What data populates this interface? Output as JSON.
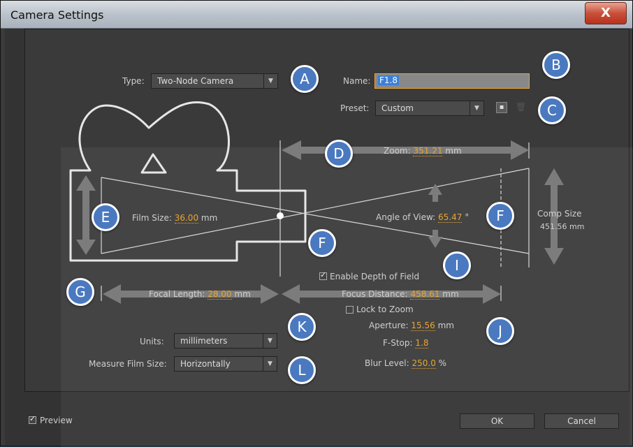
{
  "window": {
    "title": "Camera Settings",
    "close_label": "X"
  },
  "type": {
    "label": "Type:",
    "value": "Two-Node Camera"
  },
  "name": {
    "label": "Name:",
    "value": "F1.8"
  },
  "preset": {
    "label": "Preset:",
    "value": "Custom"
  },
  "zoom": {
    "label": "Zoom:",
    "value": "351.21",
    "unit": "mm"
  },
  "film_size": {
    "label": "Film Size:",
    "value": "36.00",
    "unit": "mm"
  },
  "angle_of_view": {
    "label": "Angle of View:",
    "value": "65.47",
    "unit": "°"
  },
  "comp_size": {
    "label": "Comp Size",
    "value": "451.56 mm"
  },
  "depth_of_field": {
    "label": "Enable Depth of Field",
    "checked": true
  },
  "focal_length": {
    "label": "Focal Length:",
    "value": "28.00",
    "unit": "mm"
  },
  "focus_distance": {
    "label": "Focus Distance:",
    "value": "458.61",
    "unit": "mm"
  },
  "lock_to_zoom": {
    "label": "Lock to Zoom",
    "checked": false
  },
  "aperture": {
    "label": "Aperture:",
    "value": "15.56",
    "unit": "mm"
  },
  "f_stop": {
    "label": "F-Stop:",
    "value": "1.8"
  },
  "blur_level": {
    "label": "Blur Level:",
    "value": "250.0",
    "unit": "%"
  },
  "units": {
    "label": "Units:",
    "value": "millimeters"
  },
  "measure_film_size": {
    "label": "Measure Film Size:",
    "value": "Horizontally"
  },
  "preview": {
    "label": "Preview",
    "checked": true
  },
  "buttons": {
    "ok": "OK",
    "cancel": "Cancel"
  },
  "badges": [
    "A",
    "B",
    "C",
    "D",
    "E",
    "F",
    "F",
    "G",
    "I",
    "J",
    "K",
    "L"
  ],
  "colors": {
    "accent": "#e8a531",
    "badge": "#4a79c0"
  }
}
